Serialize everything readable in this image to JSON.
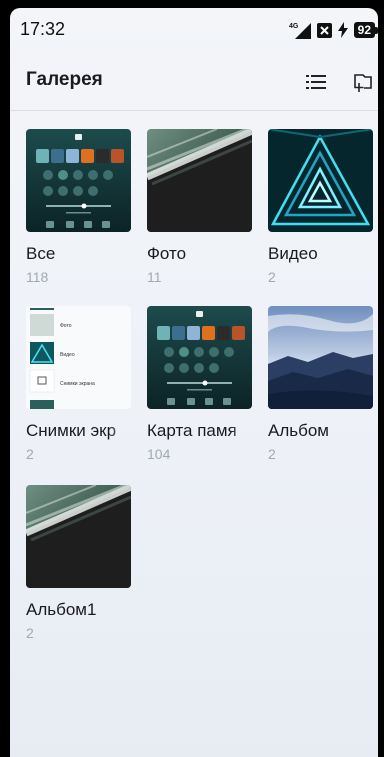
{
  "status_bar": {
    "time": "17:32",
    "network": "4G",
    "battery": "92"
  },
  "header": {
    "title": "Галерея",
    "list_icon": "list-view-icon",
    "folder_icon": "add-folder-icon"
  },
  "albums": [
    {
      "name": "Все",
      "count": "118"
    },
    {
      "name": "Фото",
      "count": "11"
    },
    {
      "name": "Видео",
      "count": "2"
    },
    {
      "name": "Снимки экр",
      "count": "2"
    },
    {
      "name": "Карта памя",
      "count": "104"
    },
    {
      "name": "Альбом",
      "count": "2"
    },
    {
      "name": "Альбом1",
      "count": "2"
    }
  ],
  "screenshot_thumb": {
    "row1": "Фото",
    "row2": "Видео",
    "row3": "Снимки экрана"
  }
}
